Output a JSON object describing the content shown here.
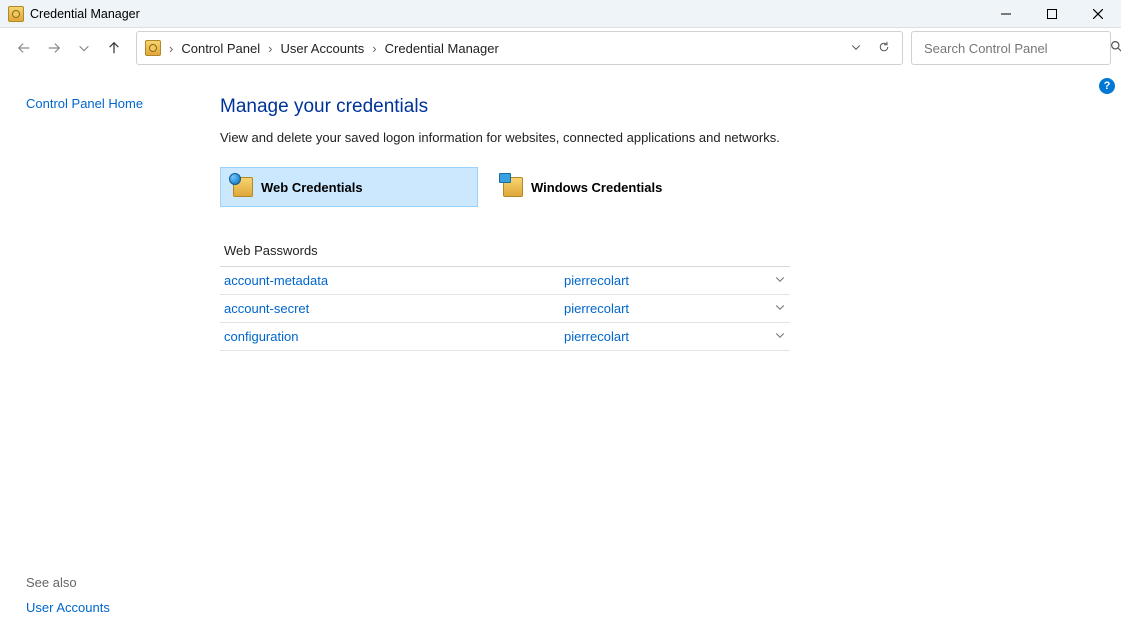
{
  "window": {
    "title": "Credential Manager"
  },
  "breadcrumb": {
    "items": [
      "Control Panel",
      "User Accounts",
      "Credential Manager"
    ]
  },
  "search": {
    "placeholder": "Search Control Panel"
  },
  "sidebar": {
    "home_link": "Control Panel Home",
    "see_also_label": "See also",
    "see_also_link": "User Accounts"
  },
  "main": {
    "title": "Manage your credentials",
    "subtitle": "View and delete your saved logon information for websites, connected applications and networks.",
    "tiles": {
      "web": "Web Credentials",
      "windows": "Windows Credentials"
    },
    "section_heading": "Web Passwords",
    "rows": [
      {
        "name": "account-metadata",
        "user": "pierrecolart"
      },
      {
        "name": "account-secret",
        "user": "pierrecolart"
      },
      {
        "name": "configuration",
        "user": "pierrecolart"
      }
    ]
  },
  "help": {
    "label": "?"
  }
}
